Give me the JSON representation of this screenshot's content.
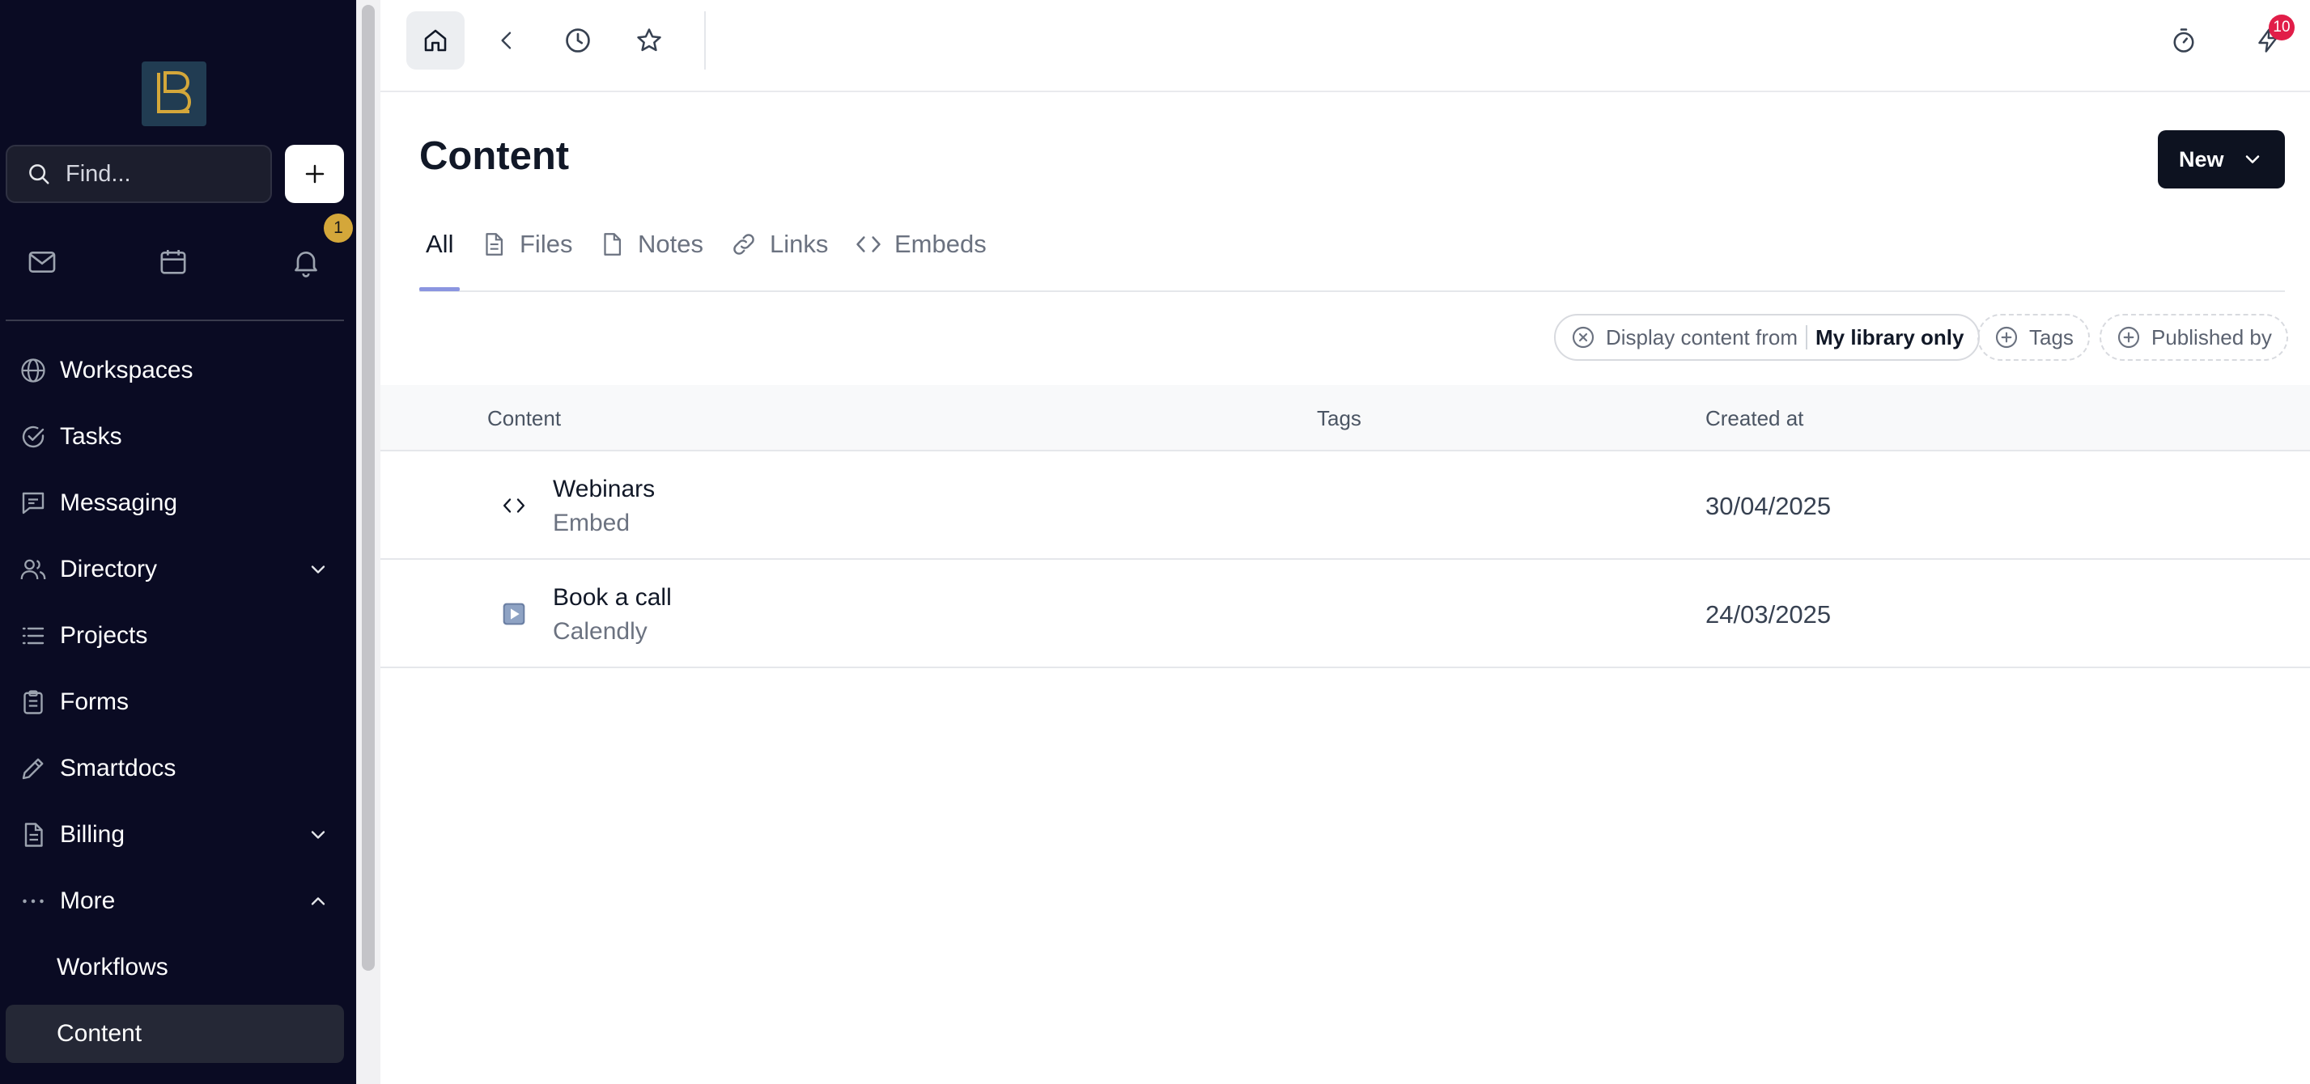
{
  "sidebar": {
    "search_placeholder": "Find...",
    "notification_count": "1",
    "nav": [
      {
        "label": "Workspaces",
        "icon": "globe-icon"
      },
      {
        "label": "Tasks",
        "icon": "check-circle-icon"
      },
      {
        "label": "Messaging",
        "icon": "message-icon"
      },
      {
        "label": "Directory",
        "icon": "users-icon",
        "expandable": true
      },
      {
        "label": "Projects",
        "icon": "list-icon"
      },
      {
        "label": "Forms",
        "icon": "clipboard-icon"
      },
      {
        "label": "Smartdocs",
        "icon": "pen-icon"
      },
      {
        "label": "Billing",
        "icon": "document-icon",
        "expandable": true
      },
      {
        "label": "More",
        "icon": "dots-icon",
        "expanded": true
      }
    ],
    "sub_nav": [
      {
        "label": "Workflows"
      },
      {
        "label": "Content",
        "active": true
      }
    ]
  },
  "topbar": {
    "bolt_badge": "10"
  },
  "main": {
    "title": "Content",
    "new_button": "New",
    "tabs": [
      {
        "label": "All",
        "active": true
      },
      {
        "label": "Files",
        "icon": "file-icon"
      },
      {
        "label": "Notes",
        "icon": "note-icon"
      },
      {
        "label": "Links",
        "icon": "link-icon"
      },
      {
        "label": "Embeds",
        "icon": "code-icon"
      }
    ],
    "filters": {
      "display_label": "Display content from",
      "display_value": "My library only",
      "tags": "Tags",
      "published_by": "Published by"
    },
    "table": {
      "columns": [
        "Content",
        "Tags",
        "Created at"
      ],
      "rows": [
        {
          "title": "Webinars",
          "subtitle": "Embed",
          "tags": "",
          "created": "30/04/2025",
          "icon": "code-icon"
        },
        {
          "title": "Book a call",
          "subtitle": "Calendly",
          "tags": "",
          "created": "24/03/2025",
          "icon": "play-icon"
        }
      ]
    }
  },
  "colors": {
    "sidebar_bg": "#0a0b23",
    "accent_gold": "#d4a73a",
    "badge_red": "#e11d48",
    "tab_underline": "#8b95e0"
  }
}
